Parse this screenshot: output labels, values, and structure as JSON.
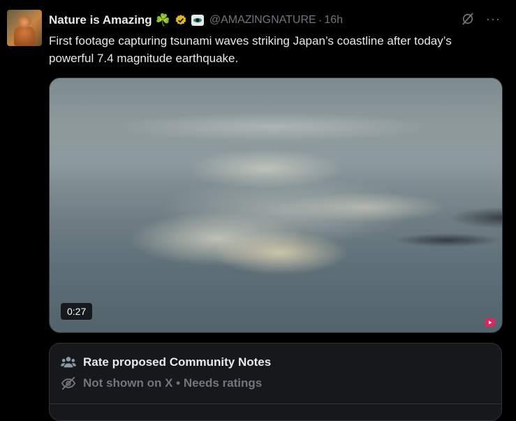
{
  "tweet": {
    "author_name": "Nature is Amazing",
    "name_emoji": "☘️",
    "handle": "@AMAZlNGNATURE",
    "separator": "·",
    "time": "16h",
    "more_label": "···",
    "text": "First footage capturing tsunami waves striking Japan’s coastline after today’s powerful 7.4 magnitude earthquake.",
    "video_duration": "0:27"
  },
  "community_notes": {
    "title": "Rate proposed Community Notes",
    "status": "Not shown on X • Needs ratings"
  },
  "colors": {
    "background": "#000000",
    "text_primary": "#e7e9ea",
    "text_secondary": "#71767b",
    "verified_gold": "#e2b719",
    "panel": "#16181c",
    "border": "#2f3336"
  },
  "icons": [
    "avatar-image",
    "clover-emoji",
    "verified-badge-icon",
    "affiliate-badge-icon",
    "grok-icon",
    "more-icon",
    "youtube-icon",
    "people-icon",
    "eye-off-icon"
  ]
}
